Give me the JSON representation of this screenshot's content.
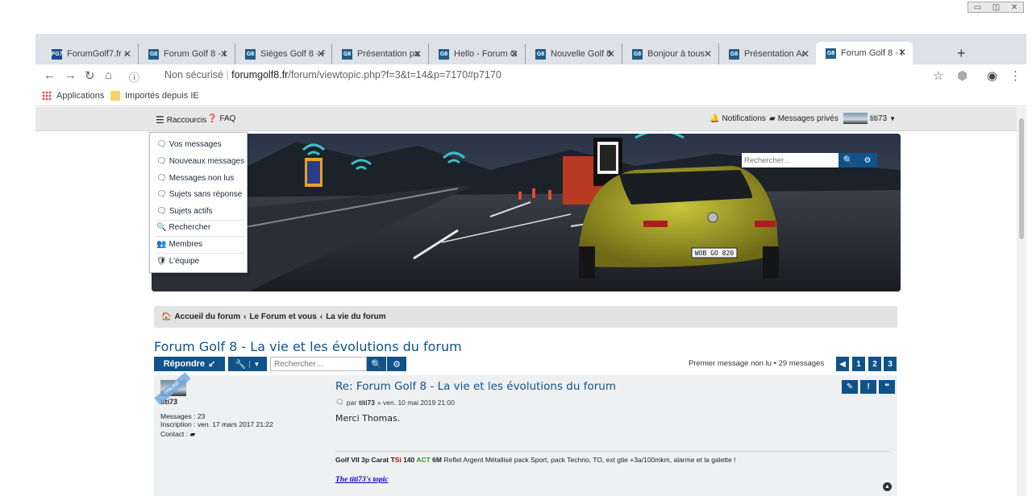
{
  "browser": {
    "tabs": [
      {
        "title": "ForumGolf7.fr -",
        "favicon": "FG7"
      },
      {
        "title": "Forum Golf 8 - I",
        "favicon": "G8"
      },
      {
        "title": "Sièges Golf 8 - F",
        "favicon": "G8"
      },
      {
        "title": "Présentation pa",
        "favicon": "G8"
      },
      {
        "title": "Hello - Forum G",
        "favicon": "G8"
      },
      {
        "title": "Nouvelle Golf 8",
        "favicon": "G8"
      },
      {
        "title": "Bonjour à tous",
        "favicon": "G8"
      },
      {
        "title": "Présentation Ar",
        "favicon": "G8"
      },
      {
        "title": "Forum Golf 8 - I",
        "favicon": "G8"
      }
    ],
    "security_label": "Non sécurisé",
    "url_host": "forumgolf8.fr",
    "url_path": "/forum/viewtopic.php?f=3&t=14&p=7170#p7170",
    "bookmarks": [
      "Applications",
      "Importés depuis IE"
    ]
  },
  "navbar": {
    "shortcuts_label": "Raccourcis",
    "faq_label": "FAQ",
    "notifications_label": "Notifications",
    "private_messages_label": "Messages privés",
    "username": "titi73"
  },
  "dropdown": {
    "items": [
      "Vos messages",
      "Nouveaux messages",
      "Messages non lus",
      "Sujets sans réponse",
      "Sujets actifs",
      "Rechercher",
      "Membres",
      "L'équipe"
    ]
  },
  "header_search": {
    "placeholder": "Rechercher…"
  },
  "banner": {
    "plate": "WOB GO 820"
  },
  "breadcrumb": [
    "Accueil du forum",
    "Le Forum et vous",
    "La vie du forum"
  ],
  "topic": {
    "title": "Forum Golf 8 - La vie et les évolutions du forum",
    "reply_label": "Répondre",
    "search_placeholder": "Rechercher…",
    "pagination_info": "Premier message non lu • 29 messages",
    "pages": [
      "1",
      "2",
      "3"
    ]
  },
  "post": {
    "author": "titi73",
    "online_badge": "ONLINE",
    "messages_label": "Messages :",
    "messages_count": "23",
    "registration_label": "Inscription :",
    "registration_date": "ven. 17 mars 2017 21:22",
    "contact_label": "Contact :",
    "subject": "Re: Forum Golf 8 - La vie et les évolutions du forum",
    "by_label": "par",
    "date": "» ven. 10 mai 2019 21:00",
    "content": "Merci Thomas.",
    "signature": {
      "model": "Golf VII 3p Carat T",
      "tsi_red": "Si",
      "engine": " 140 ",
      "act_green": "ACT",
      "gearbox": " 6M",
      "rest": " Reflet Argent Métallisé pack Sport, pack Techno, TO, ext gtie +3a/100mkm, alarme et la galette !"
    },
    "topic_link": "The titi73's topic"
  },
  "colors": {
    "primary": "#105289",
    "sig_red": "#cc0000",
    "sig_green": "#2aa02a"
  }
}
